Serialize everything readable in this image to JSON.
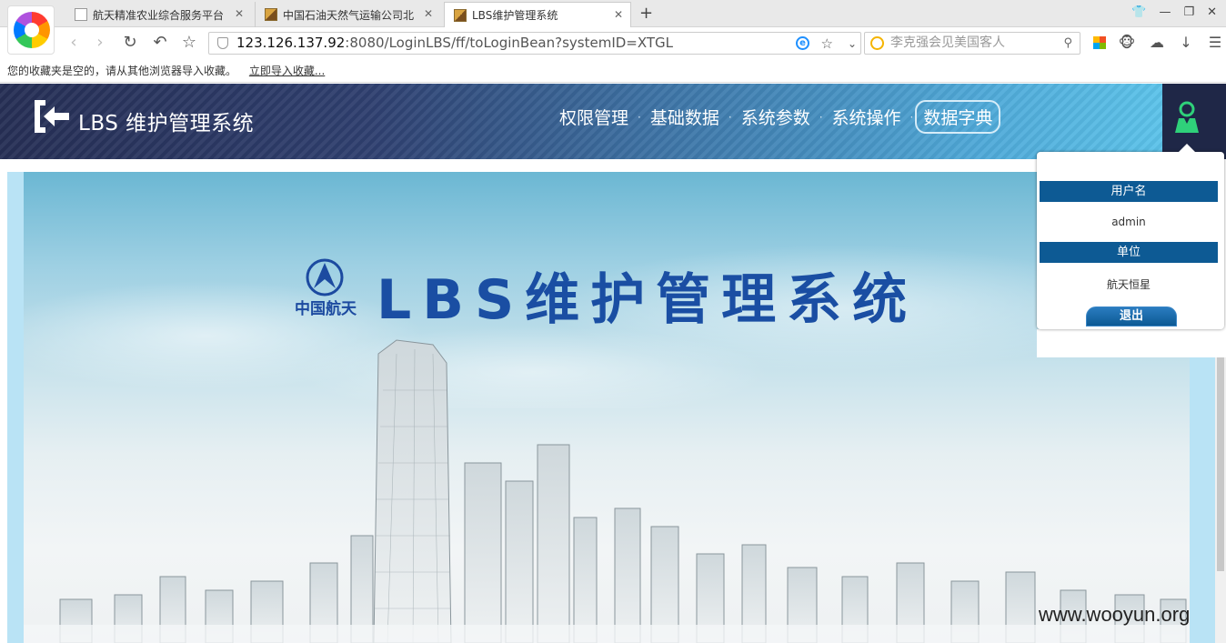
{
  "browser": {
    "tabs": [
      {
        "title": "航天精准农业综合服务平台",
        "active": false
      },
      {
        "title": "中国石油天然气运输公司北",
        "active": false
      },
      {
        "title": "LBS维护管理系统",
        "active": true
      }
    ],
    "new_tab": "+",
    "address": {
      "host": "123.126.137.92",
      "rest": ":8080/LoginLBS/ff/toLoginBean?systemID=XTGL"
    },
    "search_placeholder": "李克强会见美国客人",
    "bookmarks_text": "您的收藏夹是空的，请从其他浏览器导入收藏。",
    "bookmarks_link": "立即导入收藏..."
  },
  "header": {
    "title": "LBS 维护管理系统",
    "nav": [
      {
        "label": "权限管理",
        "active": false
      },
      {
        "label": "基础数据",
        "active": false
      },
      {
        "label": "系统参数",
        "active": false
      },
      {
        "label": "系统操作",
        "active": false
      },
      {
        "label": "数据字典",
        "active": true
      }
    ],
    "nav_separator": "·"
  },
  "banner": {
    "org_name": "中国航天",
    "title": "LBS维护管理系统"
  },
  "user_panel": {
    "username_label": "用户名",
    "username": "admin",
    "unit_label": "单位",
    "unit": "航天恒星",
    "logout_label": "退出"
  },
  "watermark": "www.wooyun.org",
  "colors": {
    "header_dark": "#262f55",
    "header_light": "#5cc3ea",
    "panel_bar": "#0d5a94",
    "banner_title": "#1a4ea3",
    "user_icon": "#2fd17a"
  }
}
